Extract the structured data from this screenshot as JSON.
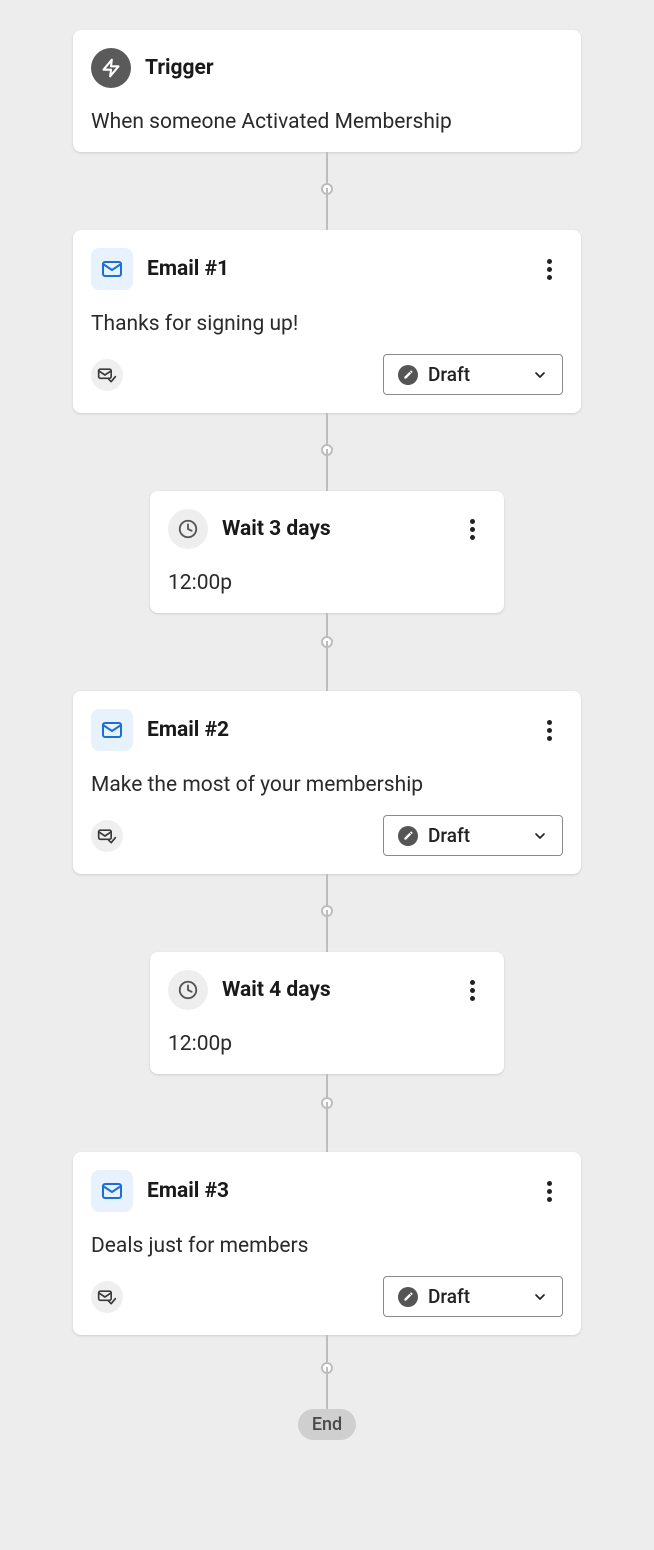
{
  "trigger": {
    "title": "Trigger",
    "description": "When someone Activated Membership"
  },
  "steps": [
    {
      "type": "email",
      "title": "Email #1",
      "subject": "Thanks for signing up!",
      "status": "Draft"
    },
    {
      "type": "wait",
      "title": "Wait 3 days",
      "time": "12:00p"
    },
    {
      "type": "email",
      "title": "Email #2",
      "subject": "Make the most of your membership",
      "status": "Draft"
    },
    {
      "type": "wait",
      "title": "Wait 4 days",
      "time": "12:00p"
    },
    {
      "type": "email",
      "title": "Email #3",
      "subject": "Deals just for members",
      "status": "Draft"
    }
  ],
  "end_label": "End"
}
